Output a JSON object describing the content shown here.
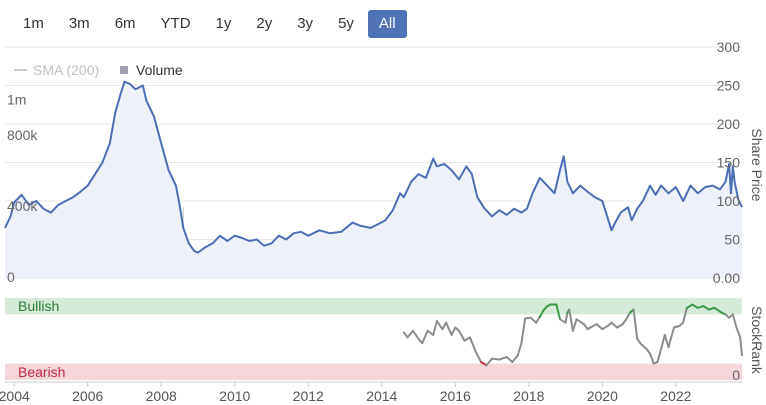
{
  "range_buttons": [
    {
      "label": "1m",
      "active": false
    },
    {
      "label": "3m",
      "active": false
    },
    {
      "label": "6m",
      "active": false
    },
    {
      "label": "YTD",
      "active": false
    },
    {
      "label": "1y",
      "active": false
    },
    {
      "label": "2y",
      "active": false
    },
    {
      "label": "3y",
      "active": false
    },
    {
      "label": "5y",
      "active": false
    },
    {
      "label": "All",
      "active": true
    }
  ],
  "colors": {
    "price_line": "#4c6eb5",
    "price_fill": "#eef1f9",
    "volume": "#d2d2d2",
    "active_button": "#4f72b8",
    "bullish_band": "#d6ead9",
    "bearish_band": "#f5d6db",
    "rank_neutral": "#8c8c8c",
    "rank_bullish": "#3a9a45",
    "rank_bearish": "#d0384e"
  },
  "chart_data": [
    {
      "type": "line",
      "title": "",
      "legend": [
        {
          "name": "SMA (200)",
          "enabled": false
        },
        {
          "name": "Volume",
          "enabled": true
        }
      ],
      "legend_placement": "top-left",
      "y_right_label": "Share Price",
      "y_right_ticks": [
        "300",
        "250",
        "200",
        "150",
        "100",
        "50",
        "0.00"
      ],
      "y_right_range": [
        0,
        300
      ],
      "y_left_ticks": [
        "1m",
        "800k",
        "400k",
        "0"
      ],
      "y_left_range": [
        0,
        1300000
      ],
      "x_ticks": [
        "2004",
        "2006",
        "2008",
        "2010",
        "2012",
        "2014",
        "2016",
        "2018",
        "2020",
        "2022"
      ],
      "x_range": [
        2003.75,
        2023.8
      ],
      "series": [
        {
          "name": "Share Price",
          "points": [
            [
              2003.75,
              65
            ],
            [
              2003.9,
              80
            ],
            [
              2004.0,
              98
            ],
            [
              2004.2,
              108
            ],
            [
              2004.4,
              95
            ],
            [
              2004.6,
              100
            ],
            [
              2004.8,
              90
            ],
            [
              2005.0,
              85
            ],
            [
              2005.2,
              95
            ],
            [
              2005.4,
              100
            ],
            [
              2005.6,
              105
            ],
            [
              2005.8,
              112
            ],
            [
              2006.0,
              120
            ],
            [
              2006.2,
              135
            ],
            [
              2006.4,
              150
            ],
            [
              2006.6,
              175
            ],
            [
              2006.75,
              215
            ],
            [
              2006.9,
              240
            ],
            [
              2007.0,
              255
            ],
            [
              2007.15,
              252
            ],
            [
              2007.3,
              245
            ],
            [
              2007.5,
              250
            ],
            [
              2007.6,
              230
            ],
            [
              2007.8,
              210
            ],
            [
              2008.0,
              175
            ],
            [
              2008.2,
              140
            ],
            [
              2008.4,
              120
            ],
            [
              2008.5,
              95
            ],
            [
              2008.6,
              65
            ],
            [
              2008.75,
              45
            ],
            [
              2008.9,
              35
            ],
            [
              2009.0,
              33
            ],
            [
              2009.2,
              40
            ],
            [
              2009.4,
              45
            ],
            [
              2009.6,
              55
            ],
            [
              2009.8,
              48
            ],
            [
              2010.0,
              55
            ],
            [
              2010.2,
              52
            ],
            [
              2010.4,
              48
            ],
            [
              2010.6,
              50
            ],
            [
              2010.8,
              42
            ],
            [
              2011.0,
              45
            ],
            [
              2011.2,
              55
            ],
            [
              2011.4,
              50
            ],
            [
              2011.6,
              58
            ],
            [
              2011.8,
              60
            ],
            [
              2012.0,
              55
            ],
            [
              2012.3,
              62
            ],
            [
              2012.6,
              58
            ],
            [
              2012.9,
              60
            ],
            [
              2013.2,
              72
            ],
            [
              2013.4,
              68
            ],
            [
              2013.7,
              65
            ],
            [
              2013.9,
              70
            ],
            [
              2014.1,
              75
            ],
            [
              2014.3,
              88
            ],
            [
              2014.5,
              110
            ],
            [
              2014.6,
              105
            ],
            [
              2014.8,
              125
            ],
            [
              2015.0,
              135
            ],
            [
              2015.2,
              130
            ],
            [
              2015.4,
              155
            ],
            [
              2015.5,
              145
            ],
            [
              2015.7,
              148
            ],
            [
              2015.9,
              140
            ],
            [
              2016.1,
              128
            ],
            [
              2016.3,
              145
            ],
            [
              2016.45,
              135
            ],
            [
              2016.6,
              105
            ],
            [
              2016.8,
              90
            ],
            [
              2017.0,
              80
            ],
            [
              2017.2,
              88
            ],
            [
              2017.4,
              82
            ],
            [
              2017.6,
              90
            ],
            [
              2017.8,
              85
            ],
            [
              2017.95,
              90
            ],
            [
              2018.1,
              110
            ],
            [
              2018.3,
              130
            ],
            [
              2018.5,
              120
            ],
            [
              2018.7,
              110
            ],
            [
              2018.85,
              140
            ],
            [
              2018.95,
              158
            ],
            [
              2019.05,
              125
            ],
            [
              2019.2,
              110
            ],
            [
              2019.4,
              120
            ],
            [
              2019.6,
              112
            ],
            [
              2019.8,
              105
            ],
            [
              2020.0,
              100
            ],
            [
              2020.1,
              85
            ],
            [
              2020.25,
              62
            ],
            [
              2020.35,
              72
            ],
            [
              2020.5,
              85
            ],
            [
              2020.7,
              92
            ],
            [
              2020.8,
              75
            ],
            [
              2020.95,
              90
            ],
            [
              2021.1,
              100
            ],
            [
              2021.3,
              120
            ],
            [
              2021.45,
              108
            ],
            [
              2021.6,
              120
            ],
            [
              2021.8,
              110
            ],
            [
              2022.0,
              118
            ],
            [
              2022.2,
              100
            ],
            [
              2022.4,
              120
            ],
            [
              2022.6,
              110
            ],
            [
              2022.8,
              118
            ],
            [
              2023.0,
              120
            ],
            [
              2023.2,
              115
            ],
            [
              2023.35,
              125
            ],
            [
              2023.45,
              148
            ],
            [
              2023.5,
              110
            ],
            [
              2023.55,
              145
            ],
            [
              2023.6,
              125
            ],
            [
              2023.7,
              102
            ],
            [
              2023.8,
              92
            ]
          ]
        },
        {
          "name": "Volume",
          "type": "bar",
          "points": [
            [
              2004.4,
              320000
            ],
            [
              2005.2,
              150000
            ],
            [
              2005.5,
              280000
            ],
            [
              2006.3,
              200000
            ],
            [
              2006.7,
              240000
            ],
            [
              2007.1,
              200000
            ],
            [
              2007.4,
              380000
            ],
            [
              2008.2,
              220000
            ],
            [
              2008.6,
              400000
            ],
            [
              2008.8,
              130000
            ],
            [
              2009.5,
              90000
            ],
            [
              2010.5,
              80000
            ],
            [
              2012.0,
              70000
            ],
            [
              2013.5,
              60000
            ],
            [
              2014.5,
              90000
            ],
            [
              2015.5,
              70000
            ],
            [
              2016.5,
              100000
            ],
            [
              2017.3,
              60000
            ],
            [
              2018.5,
              80000
            ],
            [
              2019.5,
              60000
            ],
            [
              2020.3,
              120000
            ],
            [
              2021.0,
              70000
            ],
            [
              2022.5,
              60000
            ],
            [
              2023.5,
              150000
            ],
            [
              2023.7,
              70000
            ]
          ]
        }
      ]
    },
    {
      "type": "line",
      "title": "",
      "y_right_label": "StockRank",
      "y_right_ticks": [
        "0"
      ],
      "y_range": [
        0,
        100
      ],
      "bands": [
        {
          "label": "Bullish",
          "from": 80,
          "to": 100
        },
        {
          "label": "Bearish",
          "from": 0,
          "to": 20
        }
      ],
      "x_range": [
        2003.75,
        2023.8
      ],
      "series": [
        {
          "name": "StockRank",
          "points": [
            [
              2014.6,
              58
            ],
            [
              2014.7,
              52
            ],
            [
              2014.85,
              60
            ],
            [
              2015.0,
              50
            ],
            [
              2015.1,
              45
            ],
            [
              2015.25,
              60
            ],
            [
              2015.4,
              55
            ],
            [
              2015.5,
              72
            ],
            [
              2015.65,
              62
            ],
            [
              2015.75,
              70
            ],
            [
              2015.9,
              55
            ],
            [
              2016.0,
              64
            ],
            [
              2016.1,
              60
            ],
            [
              2016.25,
              48
            ],
            [
              2016.4,
              52
            ],
            [
              2016.55,
              35
            ],
            [
              2016.7,
              22
            ],
            [
              2016.85,
              18
            ],
            [
              2017.0,
              26
            ],
            [
              2017.2,
              25
            ],
            [
              2017.4,
              28
            ],
            [
              2017.55,
              22
            ],
            [
              2017.7,
              30
            ],
            [
              2017.8,
              45
            ],
            [
              2017.9,
              75
            ],
            [
              2018.05,
              76
            ],
            [
              2018.2,
              70
            ],
            [
              2018.3,
              77
            ],
            [
              2018.4,
              85
            ],
            [
              2018.5,
              90
            ],
            [
              2018.6,
              92
            ],
            [
              2018.75,
              92
            ],
            [
              2018.85,
              74
            ],
            [
              2019.0,
              70
            ],
            [
              2019.05,
              82
            ],
            [
              2019.1,
              86
            ],
            [
              2019.2,
              60
            ],
            [
              2019.3,
              74
            ],
            [
              2019.5,
              68
            ],
            [
              2019.6,
              62
            ],
            [
              2019.75,
              66
            ],
            [
              2019.85,
              68
            ],
            [
              2020.0,
              62
            ],
            [
              2020.15,
              66
            ],
            [
              2020.25,
              70
            ],
            [
              2020.4,
              64
            ],
            [
              2020.55,
              68
            ],
            [
              2020.65,
              74
            ],
            [
              2020.75,
              82
            ],
            [
              2020.85,
              86
            ],
            [
              2020.95,
              50
            ],
            [
              2021.05,
              44
            ],
            [
              2021.2,
              38
            ],
            [
              2021.3,
              32
            ],
            [
              2021.4,
              20
            ],
            [
              2021.5,
              22
            ],
            [
              2021.6,
              38
            ],
            [
              2021.7,
              55
            ],
            [
              2021.8,
              40
            ],
            [
              2021.95,
              64
            ],
            [
              2022.1,
              66
            ],
            [
              2022.2,
              70
            ],
            [
              2022.3,
              88
            ],
            [
              2022.45,
              92
            ],
            [
              2022.6,
              88
            ],
            [
              2022.75,
              90
            ],
            [
              2022.9,
              86
            ],
            [
              2023.05,
              88
            ],
            [
              2023.15,
              85
            ],
            [
              2023.25,
              82
            ],
            [
              2023.35,
              80
            ],
            [
              2023.45,
              76
            ],
            [
              2023.55,
              80
            ],
            [
              2023.65,
              64
            ],
            [
              2023.75,
              52
            ],
            [
              2023.8,
              30
            ]
          ]
        }
      ]
    }
  ]
}
